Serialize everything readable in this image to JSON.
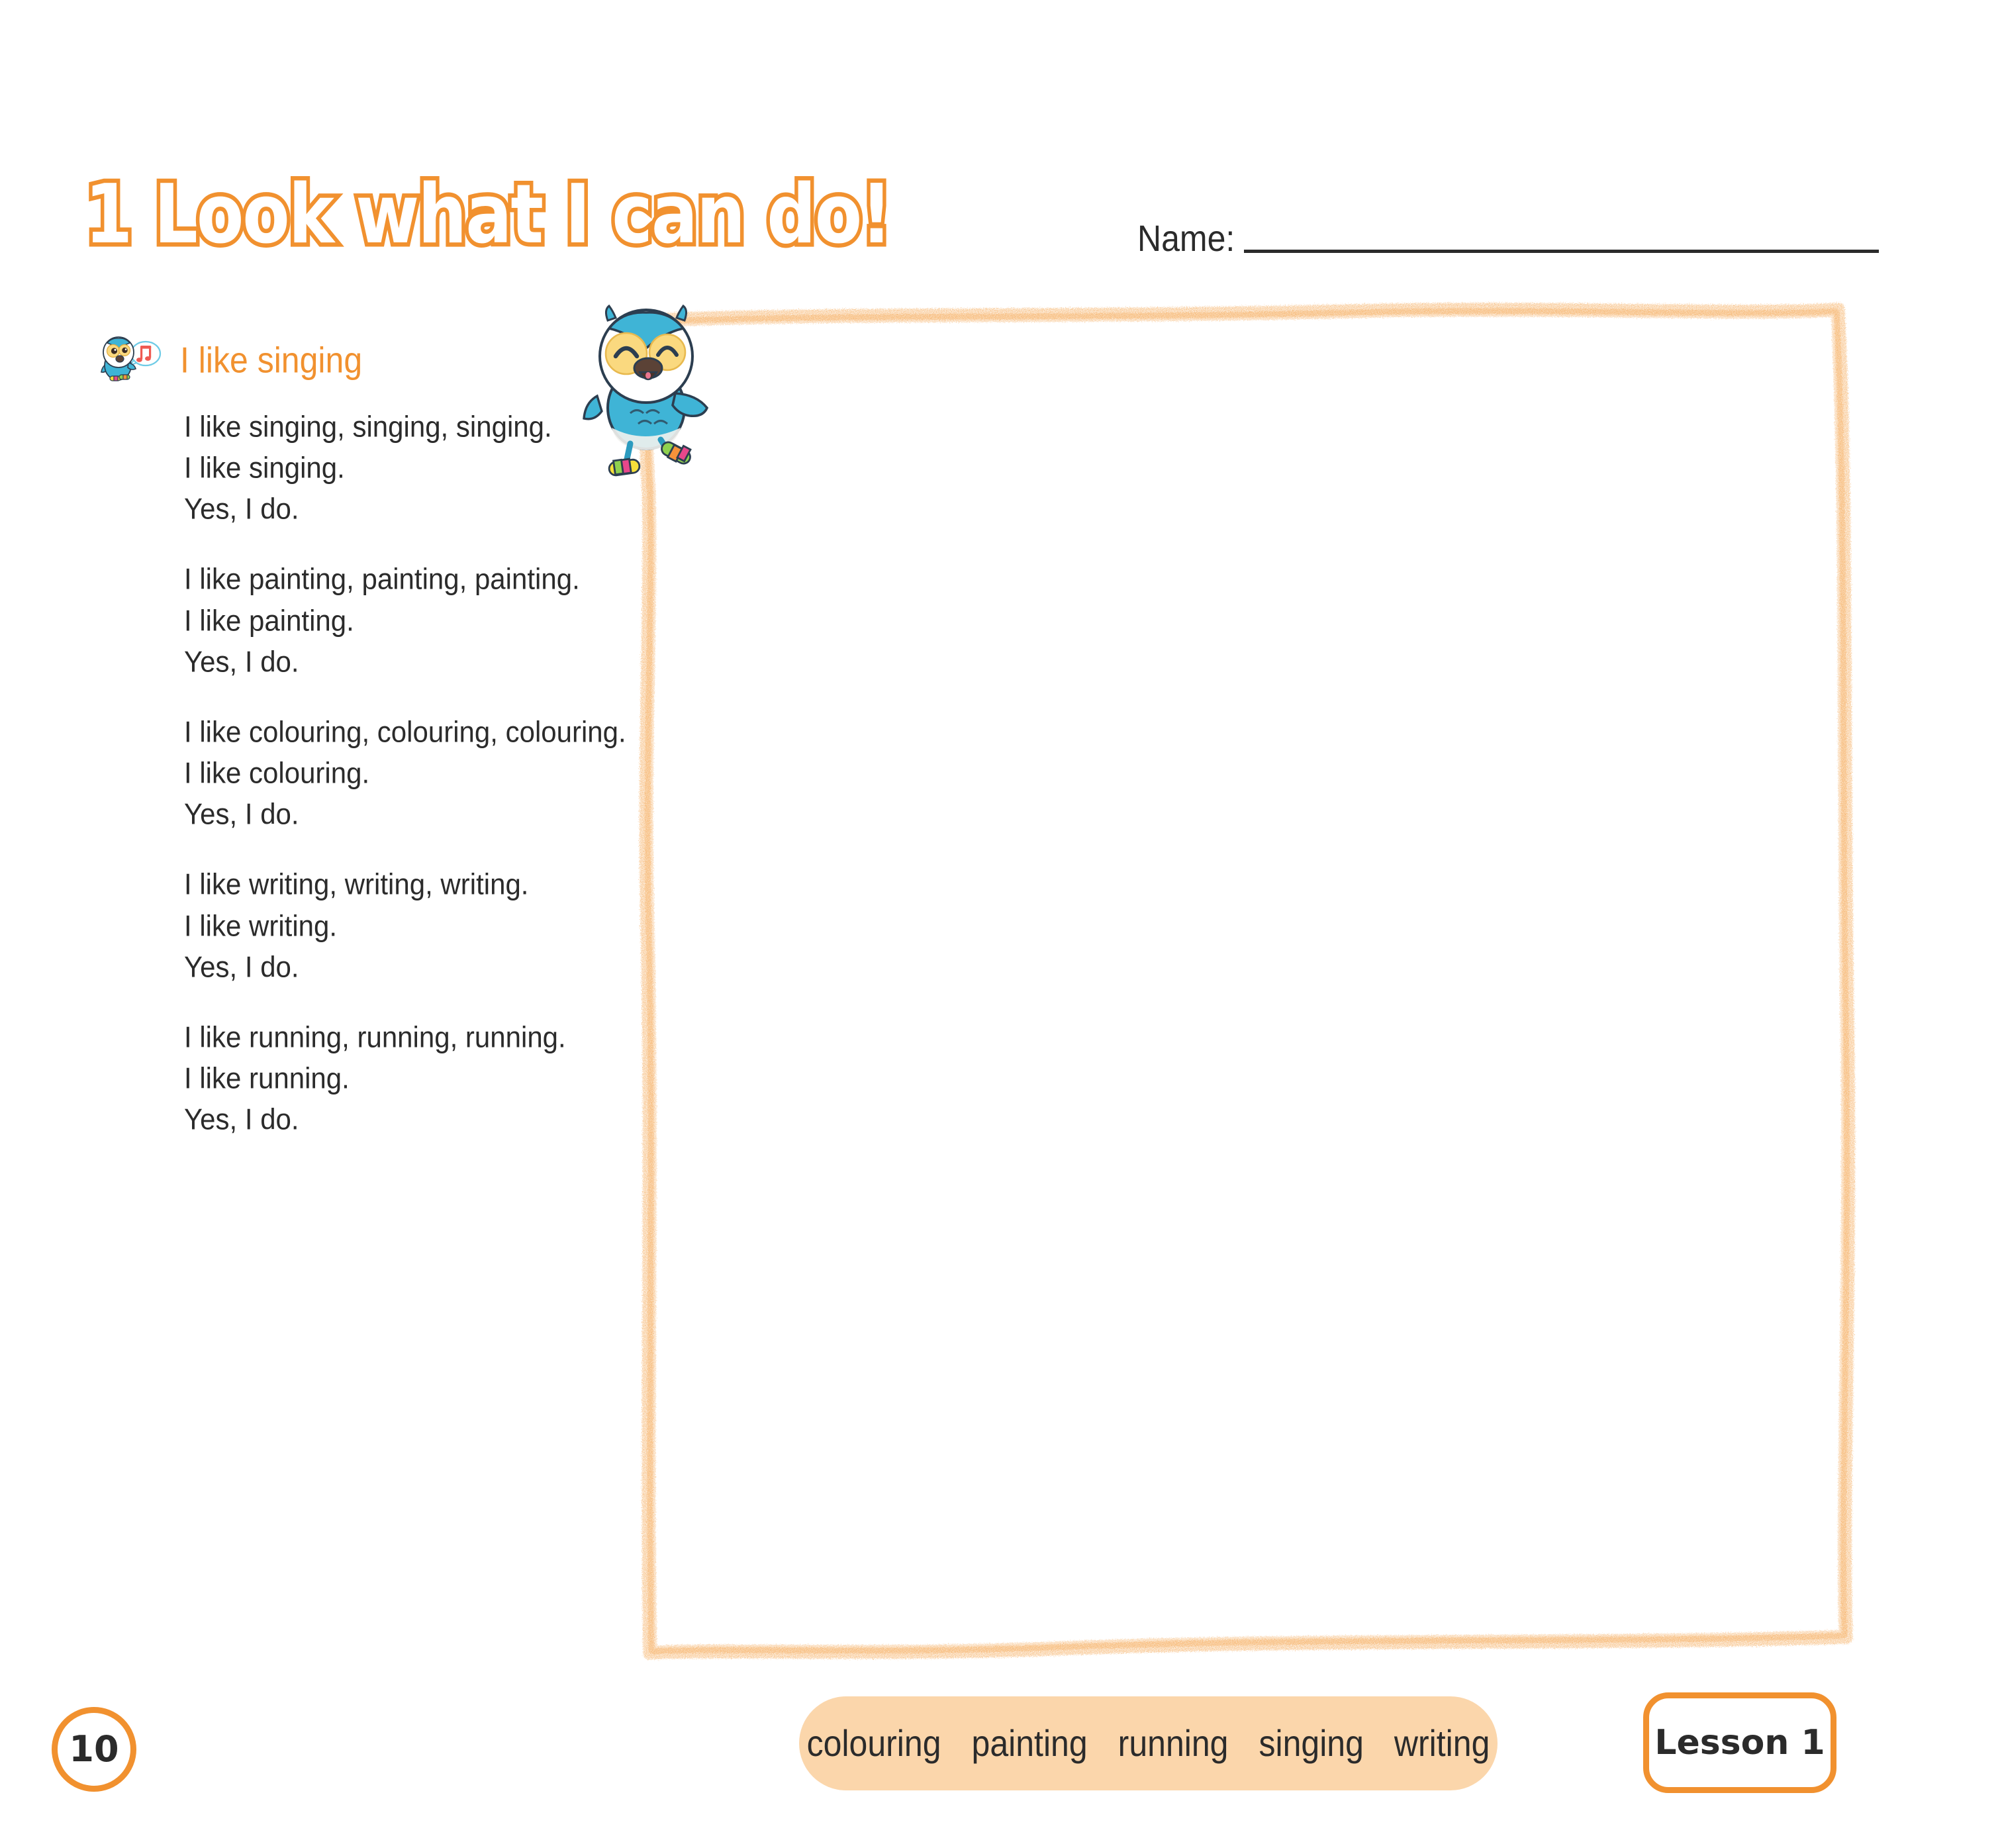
{
  "header": {
    "activity_number": "1",
    "title": "1 Look what I can do!",
    "name_label": "Name:",
    "name_value": ""
  },
  "song": {
    "title": "I like singing",
    "bird_icon": "owl-with-music-note-icon",
    "verses": [
      {
        "lines": [
          "I like singing, singing, singing.",
          "I like singing.",
          "Yes, I do."
        ]
      },
      {
        "lines": [
          "I like painting, painting, painting.",
          "I like painting.",
          "Yes, I do."
        ]
      },
      {
        "lines": [
          "I like colouring, colouring, colouring.",
          "I like colouring.",
          "Yes, I do."
        ]
      },
      {
        "lines": [
          "I like writing, writing, writing.",
          "I like writing.",
          "Yes, I do."
        ]
      },
      {
        "lines": [
          "I like running, running, running.",
          "I like running.",
          "Yes, I do."
        ]
      }
    ]
  },
  "drawing_area": {
    "label": "empty-crayon-drawing-frame",
    "mascot": "owl-mascot-with-sneakers"
  },
  "footer": {
    "page_number": "10",
    "word_bank": [
      "colouring",
      "painting",
      "running",
      "singing",
      "writing"
    ],
    "lesson_label": "Lesson 1"
  },
  "colors": {
    "accent_orange": "#F1912F",
    "word_bank_peach": "#FBD6AB",
    "text_dark": "#2b2b2b",
    "mascot_blue": "#3FB4D6",
    "mascot_eye_yellow": "#FAD97F",
    "music_note_red": "#EE5A52"
  }
}
